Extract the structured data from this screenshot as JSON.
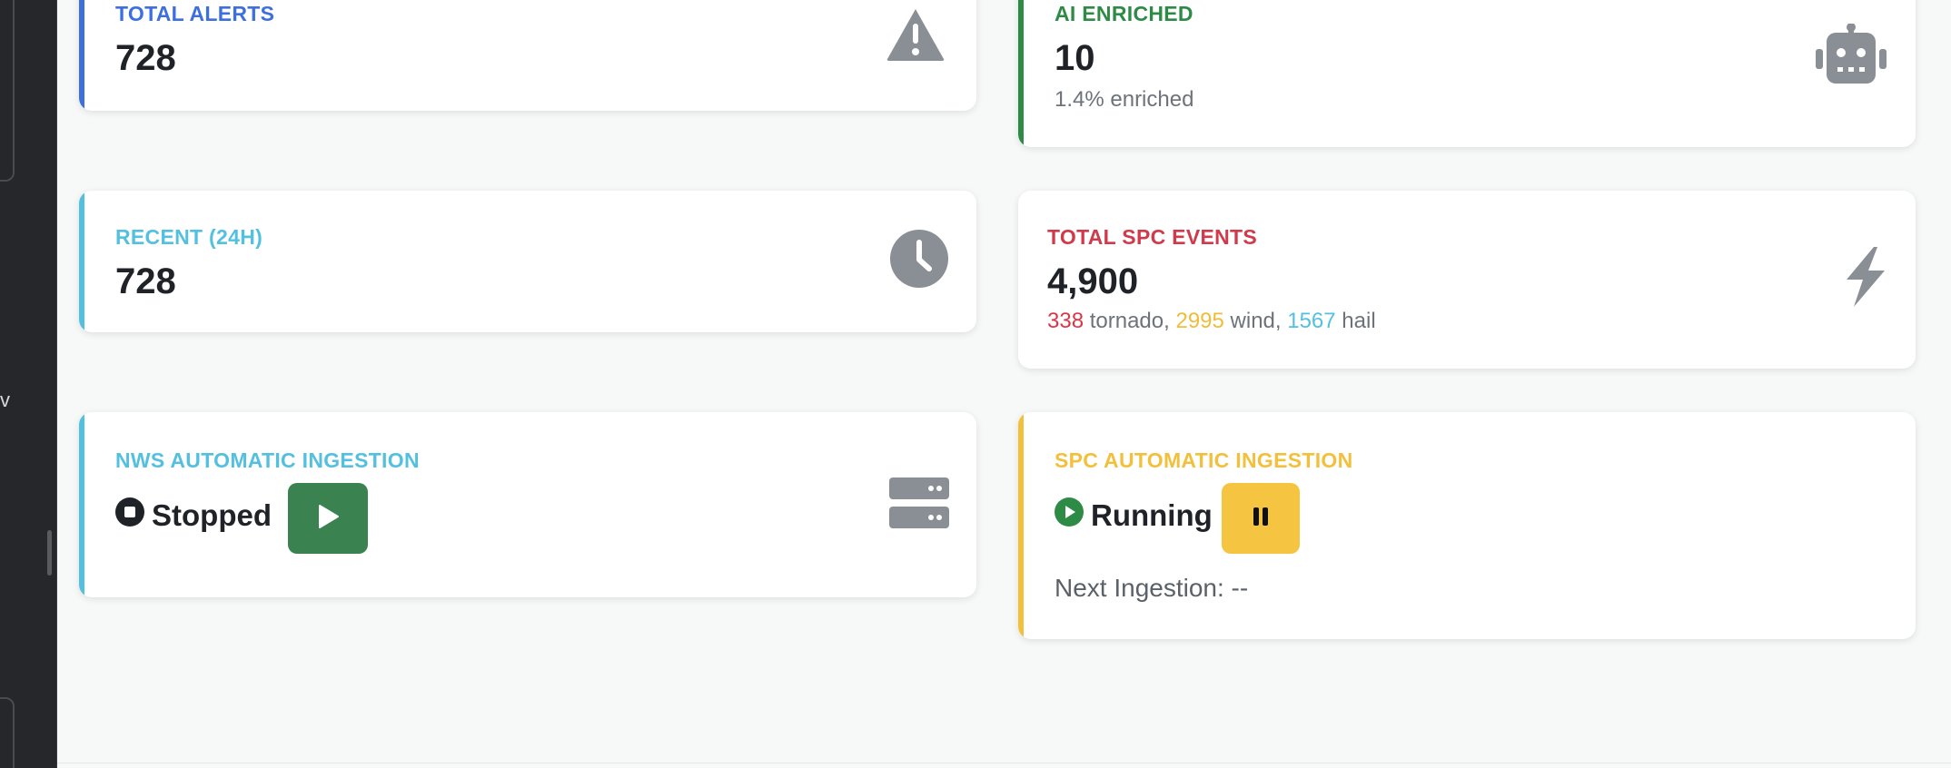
{
  "colors": {
    "blue": "#3d6fdf",
    "green": "#2e8b46",
    "cyan": "#54c0e0",
    "red": "#d03a4a",
    "yellow": "#f3c03c",
    "gray_icon": "#8a8f96",
    "play_button": "#3a8350",
    "pause_button": "#f5c440"
  },
  "sidebar": {
    "fragments": [
      "v"
    ]
  },
  "cards": {
    "total_alerts": {
      "title": "TOTAL ALERTS",
      "value": "728",
      "icon": "warning-triangle-icon"
    },
    "ai_enriched": {
      "title": "AI ENRICHED",
      "value": "10",
      "subtitle": "1.4% enriched",
      "icon": "robot-icon"
    },
    "recent_24h": {
      "title": "RECENT (24H)",
      "value": "728",
      "icon": "clock-icon"
    },
    "total_spc": {
      "title": "TOTAL SPC EVENTS",
      "value": "4,900",
      "breakdown": {
        "tornado_count": "338",
        "tornado_label": "tornado,",
        "wind_count": "2995",
        "wind_label": "wind,",
        "hail_count": "1567",
        "hail_label": "hail"
      },
      "icon": "lightning-bolt-icon"
    },
    "nws_ingestion": {
      "title": "NWS AUTOMATIC INGESTION",
      "status": "Stopped",
      "status_icon": "stop-circle-icon",
      "button_icon": "play-icon",
      "icon": "server-icon"
    },
    "spc_ingestion": {
      "title": "SPC AUTOMATIC INGESTION",
      "status": "Running",
      "status_icon": "play-circle-icon",
      "button_icon": "pause-icon",
      "next_ingestion": "Next Ingestion: --"
    }
  }
}
